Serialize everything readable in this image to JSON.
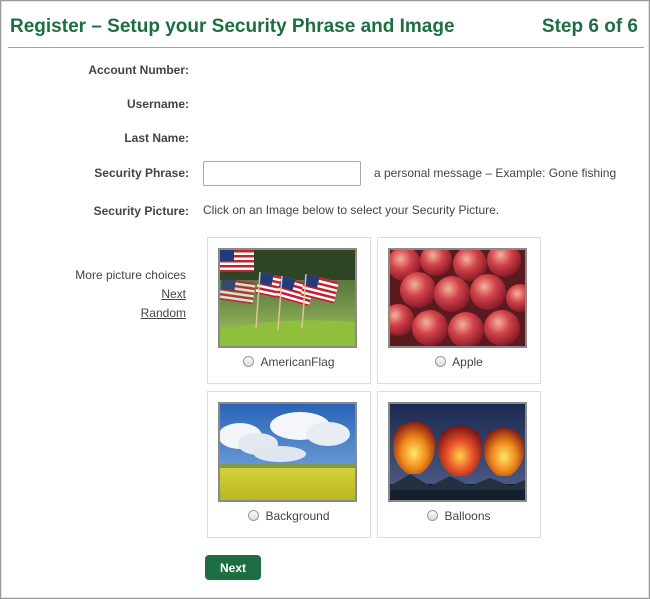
{
  "header": {
    "title": "Register – Setup your Security Phrase and Image",
    "step": "Step 6 of 6"
  },
  "form": {
    "account_number_label": "Account Number:",
    "username_label": "Username:",
    "last_name_label": "Last Name:",
    "security_phrase_label": "Security Phrase:",
    "security_phrase_value": "",
    "security_phrase_hint": "a personal message – Example: Gone fishing",
    "security_picture_label": "Security Picture:",
    "security_picture_instruction": "Click on an Image below to select your Security Picture."
  },
  "choices": {
    "caption": "More picture choices",
    "next_link": "Next",
    "random_link": "Random"
  },
  "pictures": [
    {
      "label": "AmericanFlag",
      "icon": "american-flag-photo"
    },
    {
      "label": "Apple",
      "icon": "apple-photo"
    },
    {
      "label": "Background",
      "icon": "background-photo"
    },
    {
      "label": "Balloons",
      "icon": "balloons-photo"
    }
  ],
  "colors": {
    "brand_green": "#1d6e42"
  },
  "actions": {
    "next_button": "Next"
  }
}
